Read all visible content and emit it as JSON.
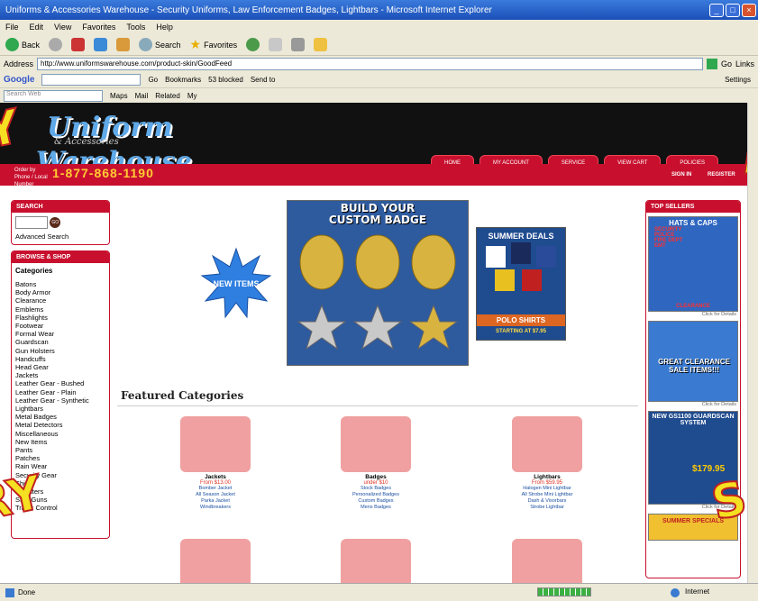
{
  "browser": {
    "title": "Uniforms & Accessories Warehouse - Security Uniforms, Law Enforcement Badges, Lightbars - Microsoft Internet Explorer",
    "menu": [
      "File",
      "Edit",
      "View",
      "Favorites",
      "Tools",
      "Help"
    ],
    "toolbar": {
      "back": "Back",
      "search": "Search",
      "favorites": "Favorites"
    },
    "address_label": "Address",
    "address": "http://www.uniformswarehouse.com/product-skin/GoodFeed",
    "go_label": "Go",
    "links_label": "Links",
    "google_label": "Google",
    "google_items": [
      "Go",
      "Bookmarks",
      "53 blocked",
      "Send to",
      "Settings"
    ],
    "search_placeholder": "Search Web",
    "searchbar_items": [
      "Maps",
      "Mail",
      "Related",
      "My"
    ]
  },
  "site": {
    "logo_top": "Uniform",
    "logo_mid": "& Accessories",
    "logo_bottom": "Warehouse",
    "order_note": "Order by Phone / Local Number",
    "phone": "1-877-868-1190",
    "nav": [
      "HOME",
      "MY ACCOUNT",
      "SERVICE",
      "VIEW CART",
      "POLICIES"
    ],
    "sign_in": "SIGN IN",
    "register": "REGISTER"
  },
  "sidebar": {
    "search_title": "SEARCH",
    "go_btn": "GO",
    "advanced": "Advanced Search",
    "browse_title": "BROWSE & SHOP",
    "categories_title": "Categories",
    "categories": [
      "Batons",
      "Body Armor",
      "Clearance",
      "Emblems",
      "Flashlights",
      "Footwear",
      "Formal Wear",
      "Guardscan",
      "Gun Holsters",
      "Handcuffs",
      "Head Gear",
      "Jackets",
      "Leather Gear - Bushed",
      "Leather Gear - Plain",
      "Leather Gear - Synthetic",
      "Lightbars",
      "Metal Badges",
      "Metal Detectors",
      "Miscellaneous",
      "New Items",
      "Pants",
      "Patches",
      "Rain Wear",
      "Security Gear",
      "Shirts",
      "Sweaters",
      "Stun Guns",
      "Traffic Control"
    ]
  },
  "main": {
    "new_items": "NEW ITEMS",
    "badge_title": "BUILD YOUR CUSTOM BADGE",
    "summer_title": "SUMMER DEALS",
    "summer_sub": "POLO SHIRTS",
    "summer_price": "STARTING AT $7.95",
    "featured_title": "Featured Categories",
    "cards": [
      {
        "name": "Jackets",
        "price": "From $13.00",
        "links": [
          "Bomber Jacket",
          "All Season Jacket",
          "Parka Jacket",
          "Windbreakers"
        ]
      },
      {
        "name": "Badges",
        "price": "under $10",
        "links": [
          "Stock Badges",
          "Personalized Badges",
          "Custom Badges",
          "Mens Badges"
        ]
      },
      {
        "name": "Lightbars",
        "price": "From $59.95",
        "links": [
          "Halogen Mini Lightbar",
          "All Strobe Mini Lightbar",
          "Dash & Visorbars",
          "Strobe Lightbar"
        ]
      }
    ]
  },
  "right": {
    "title": "TOP SELLERS",
    "hats_title": "HATS & CAPS",
    "hats_lines": [
      "SECURITY",
      "POLICE",
      "FIRE DEPT",
      "EMT"
    ],
    "hats_banner": "CLEARANCE",
    "clearance": "GREAT CLEARANCE SALE ITEMS!!!",
    "guardscan": "NEW GS1100 GUARDSCAN SYSTEM",
    "guardscan_price": "$179.95",
    "click": "Click for Details",
    "summer_specials": "SUMMER SPECIALS"
  },
  "overlay": {
    "left_top": "Y",
    "left_bottom": "RY",
    "right_top": "A",
    "right_bottom": "SA"
  },
  "status": {
    "done": "Done",
    "zone": "Internet"
  }
}
